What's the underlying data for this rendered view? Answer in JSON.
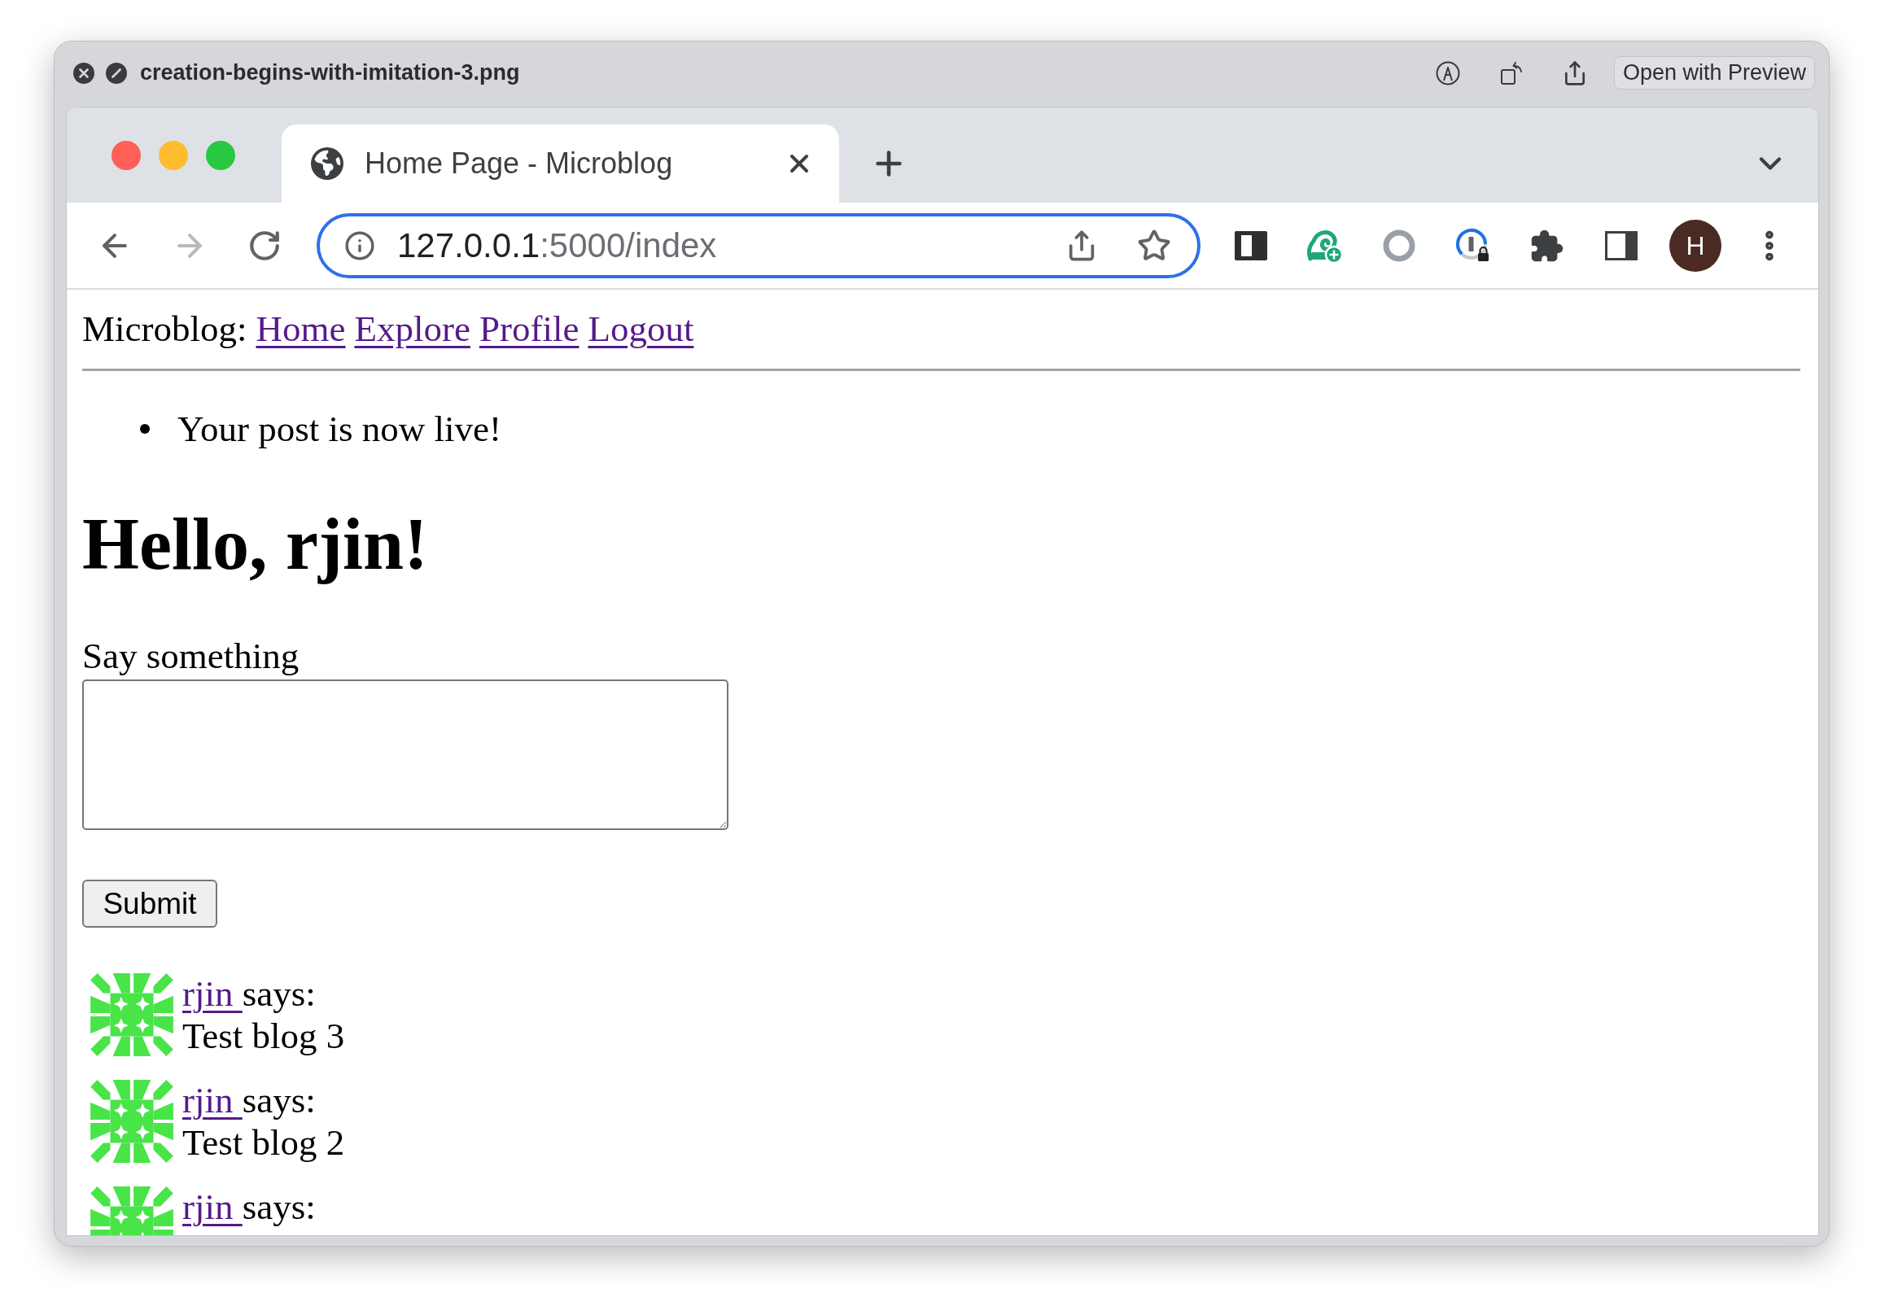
{
  "preview_window": {
    "title": "creation-begins-with-imitation-3.png",
    "open_button": "Open with Preview"
  },
  "browser": {
    "tabs": [
      {
        "title": "Home Page - Microblog",
        "selected": true
      }
    ],
    "forward_disabled": true,
    "address": {
      "host": "127.0.0.1",
      "path": ":5000/index",
      "focused": true
    },
    "profile_initial": "H"
  },
  "page": {
    "nav": {
      "brand": "Microblog:",
      "links": [
        {
          "label": "Home",
          "visited": true
        },
        {
          "label": "Explore",
          "visited": true
        },
        {
          "label": "Profile",
          "visited": true
        },
        {
          "label": "Logout",
          "visited": true
        }
      ]
    },
    "flash_messages": [
      "Your post is now live!"
    ],
    "heading": "Hello, rjin!",
    "form": {
      "label": "Say something",
      "button": "Submit"
    },
    "posts": [
      {
        "author": {
          "label": "rjin ",
          "visited": true
        },
        "says": "says:",
        "body": "Test blog 3"
      },
      {
        "author": {
          "label": "rjin ",
          "visited": true
        },
        "says": "says:",
        "body": "Test blog 2"
      },
      {
        "author": {
          "label": "rjin ",
          "visited": true
        },
        "says": "says:"
      }
    ]
  }
}
